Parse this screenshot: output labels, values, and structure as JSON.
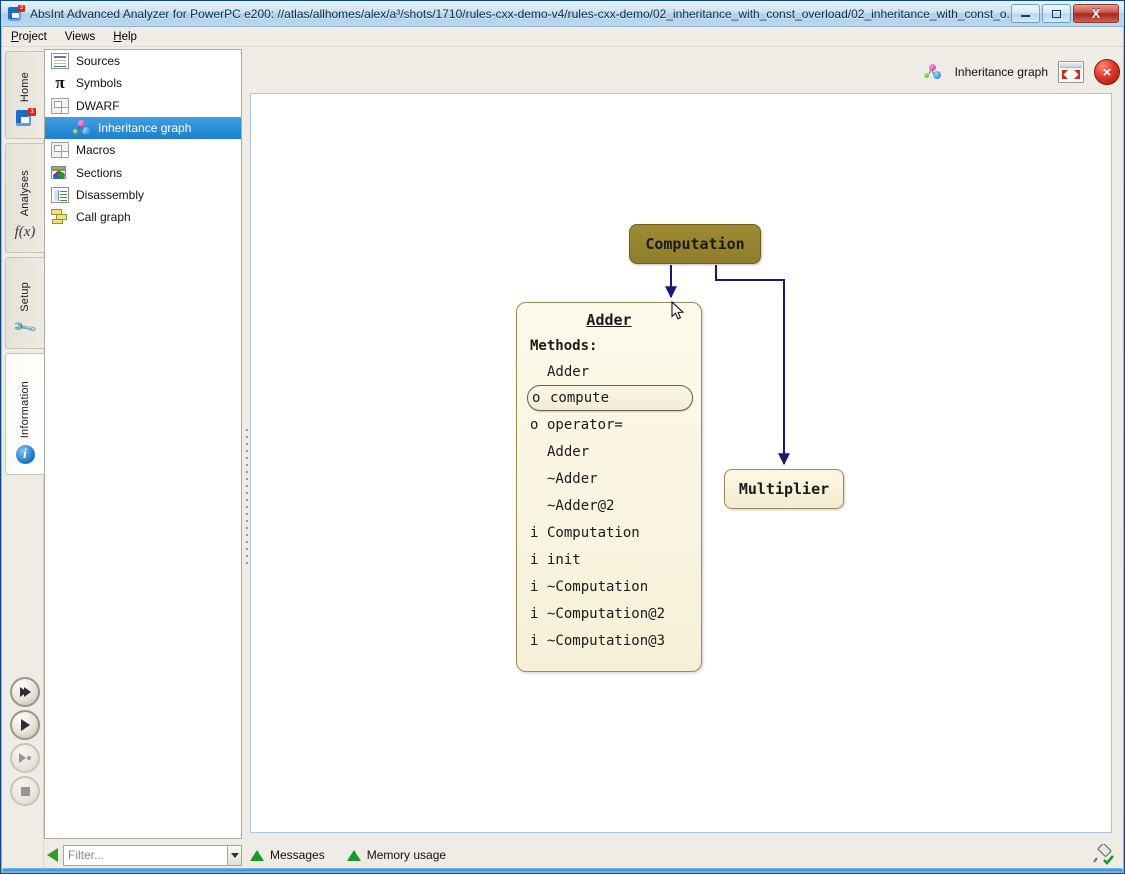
{
  "window": {
    "title": "AbsInt Advanced Analyzer for PowerPC e200: //atlas/allhomes/alex/a³/shots/1710/rules-cxx-demo-v4/rules-cxx-demo/02_inheritance_with_const_overload/02_inheritance_with_const_o...",
    "app_icon": "absint-a3-icon",
    "minimize_label": "",
    "maximize_label": "",
    "close_label": "X"
  },
  "menubar": {
    "items": [
      {
        "label": "Project",
        "mnemonic": "P"
      },
      {
        "label": "Views",
        "mnemonic": ""
      },
      {
        "label": "Help",
        "mnemonic": "H"
      }
    ]
  },
  "vertical_tabs": [
    {
      "label": "Home",
      "icon": "a3-logo-icon",
      "selected": false
    },
    {
      "label": "Analyses",
      "icon": "fx-icon",
      "selected": false
    },
    {
      "label": "Setup",
      "icon": "wrench-icon",
      "selected": false
    },
    {
      "label": "Information",
      "icon": "info-icon",
      "selected": true
    }
  ],
  "run_controls": [
    {
      "name": "run-all-button",
      "icon": "fast-forward-icon",
      "enabled": true
    },
    {
      "name": "run-button",
      "icon": "play-icon",
      "enabled": true
    },
    {
      "name": "step-button",
      "icon": "play-step-icon",
      "enabled": false
    },
    {
      "name": "stop-button",
      "icon": "stop-icon",
      "enabled": false
    }
  ],
  "tree": {
    "items": [
      {
        "label": "Sources",
        "icon": "sources-icon",
        "selected": false,
        "child": false
      },
      {
        "label": "Symbols",
        "icon": "pi-icon",
        "selected": false,
        "child": false
      },
      {
        "label": "DWARF",
        "icon": "dwarf-icon",
        "selected": false,
        "child": false
      },
      {
        "label": "Inheritance graph",
        "icon": "inheritance-graph-icon",
        "selected": true,
        "child": true
      },
      {
        "label": "Macros",
        "icon": "macros-icon",
        "selected": false,
        "child": false
      },
      {
        "label": "Sections",
        "icon": "sections-icon",
        "selected": false,
        "child": false
      },
      {
        "label": "Disassembly",
        "icon": "disassembly-icon",
        "selected": false,
        "child": false
      },
      {
        "label": "Call graph",
        "icon": "call-graph-icon",
        "selected": false,
        "child": false
      }
    ]
  },
  "graph_toolbar": {
    "view_label": "Inheritance graph",
    "view_icon": "inheritance-graph-icon",
    "expand_button": "expand-window-icon",
    "close_button": "×"
  },
  "graph": {
    "nodes": [
      {
        "id": "computation",
        "label": "Computation",
        "style": "base-class",
        "color": "#96842e"
      },
      {
        "id": "multiplier",
        "label": "Multiplier",
        "style": "derived-class",
        "color": "#f7f1da"
      },
      {
        "id": "adder",
        "label": "Adder",
        "style": "derived-class-expanded",
        "color": "#faf5e1"
      }
    ],
    "edges": [
      {
        "from": "computation",
        "to": "adder"
      },
      {
        "from": "computation",
        "to": "multiplier"
      }
    ],
    "adder_section_label": "Methods:",
    "adder_methods": [
      {
        "kind": "",
        "name": "Adder",
        "highlighted": false
      },
      {
        "kind": "o",
        "name": "compute",
        "highlighted": true
      },
      {
        "kind": "o",
        "name": "operator=",
        "highlighted": false
      },
      {
        "kind": "",
        "name": "Adder",
        "highlighted": false
      },
      {
        "kind": "",
        "name": "~Adder",
        "highlighted": false
      },
      {
        "kind": "",
        "name": "~Adder@2",
        "highlighted": false
      },
      {
        "kind": "i",
        "name": "Computation",
        "highlighted": false
      },
      {
        "kind": "i",
        "name": "init",
        "highlighted": false
      },
      {
        "kind": "i",
        "name": "~Computation",
        "highlighted": false
      },
      {
        "kind": "i",
        "name": "~Computation@2",
        "highlighted": false
      },
      {
        "kind": "i",
        "name": "~Computation@3",
        "highlighted": false
      }
    ]
  },
  "bottom": {
    "filter_placeholder": "Filter...",
    "filter_value": "",
    "collapse_icon": "green-left-arrow-icon",
    "dropdown_icon": "chevron-down-icon",
    "status_items": [
      {
        "label": "Messages",
        "icon": "green-triangle-icon"
      },
      {
        "label": "Memory usage",
        "icon": "green-triangle-icon"
      }
    ],
    "connection_icon": "plug-connected-icon"
  }
}
